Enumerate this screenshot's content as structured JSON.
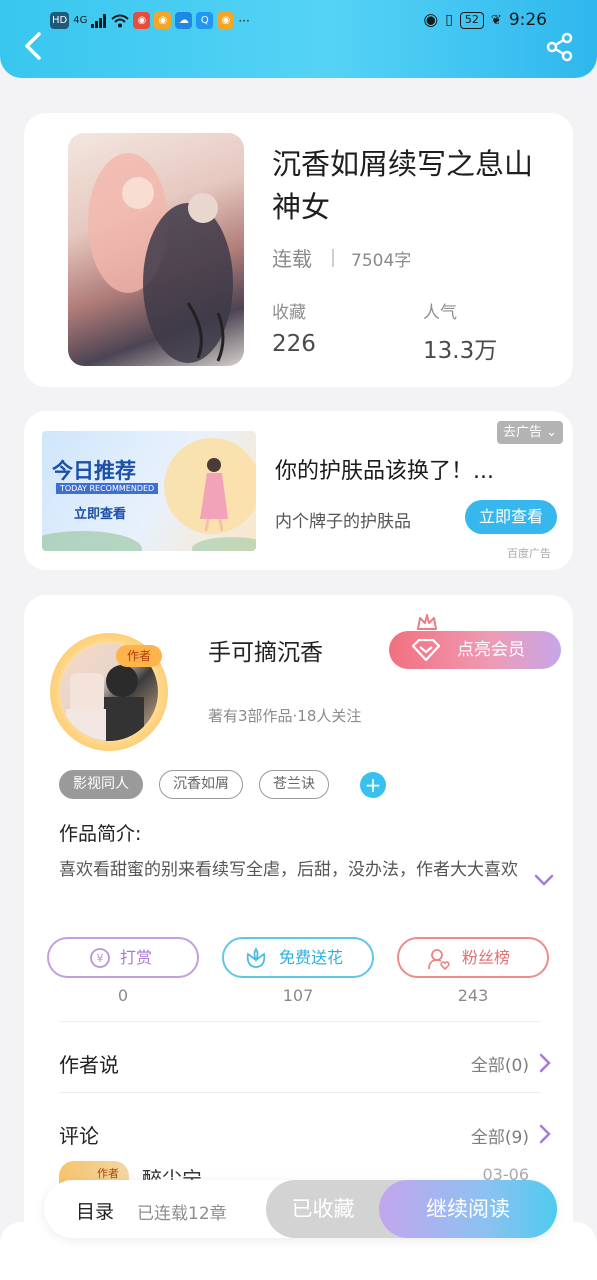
{
  "status_bar": {
    "left_labels": [
      "HD",
      "4G"
    ],
    "battery": "52",
    "time": "9:26"
  },
  "header": {
    "back_icon": "chevron-left-icon",
    "share_icon": "share-icon"
  },
  "book": {
    "title": "沉香如屑续写之息山神女",
    "status": "连载",
    "word_count": "7504字",
    "stats": [
      {
        "label": "收藏",
        "value": "226"
      },
      {
        "label": "人气",
        "value": "13.3万"
      }
    ]
  },
  "ad": {
    "close_label": "去广告",
    "image_heading": "今日推荐",
    "image_subheading": "TODAY RECOMMENDED",
    "image_cta": "立即查看",
    "title": "你的护肤品该换了！...",
    "description": "内个牌子的护肤品",
    "cta": "立即查看",
    "source": "百度广告"
  },
  "author": {
    "badge": "作者",
    "name": "手可摘沉香",
    "meta": "著有3部作品·18人关注",
    "vip_label": "点亮会员",
    "tags": [
      {
        "label": "影视同人",
        "active": true
      },
      {
        "label": "沉香如屑",
        "active": false
      },
      {
        "label": "苍兰诀",
        "active": false
      }
    ],
    "add_tag": "+",
    "intro_label": "作品简介:",
    "intro_text": "喜欢看甜蜜的别来看续写全虐，后甜，没办法，作者大大喜欢",
    "actions": [
      {
        "label": "打赏",
        "count": "0",
        "icon": "yuan-coin-icon",
        "color": "#a97ad2"
      },
      {
        "label": "免费送花",
        "count": "107",
        "icon": "flower-icon",
        "color": "#2fb0df"
      },
      {
        "label": "粉丝榜",
        "count": "243",
        "icon": "fan-user-icon",
        "color": "#e37070"
      }
    ],
    "author_says": {
      "title": "作者说",
      "link": "全部(0)"
    },
    "comments": {
      "title": "评论",
      "link": "全部(9)"
    },
    "comment_preview": {
      "badge": "作者",
      "name": "醉尘宁",
      "time": "03-06"
    }
  },
  "bottom_bar": {
    "toc_label": "目录",
    "toc_count": "已连载12章",
    "collected": "已收藏",
    "continue": "继续阅读"
  }
}
